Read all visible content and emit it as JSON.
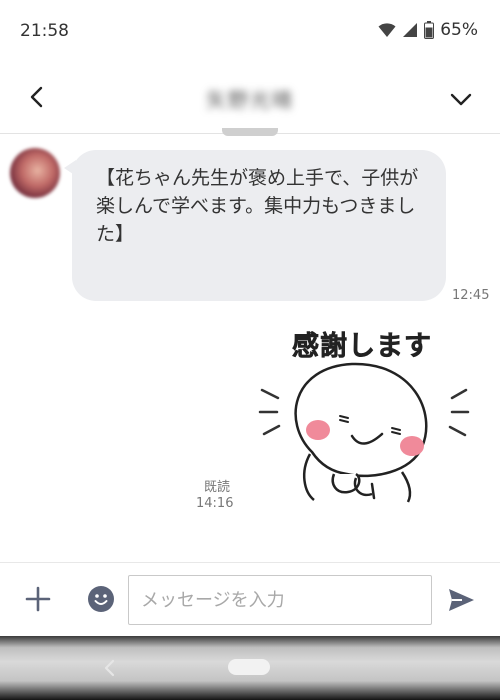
{
  "status_bar": {
    "time": "21:58",
    "battery": "65%",
    "icons": [
      "wifi-icon",
      "cell-signal-icon",
      "battery-icon"
    ]
  },
  "header": {
    "contact_name": "矢野光晴",
    "back_icon": "chevron-left-icon",
    "menu_icon": "chevron-down-icon"
  },
  "messages": [
    {
      "sender": "contact",
      "text": "【花ちゃん先生が褒め上手で、子供が楽しんで学べます。集中力もつきました】",
      "time": "12:45"
    },
    {
      "sender": "self",
      "type": "sticker",
      "sticker_text": "感謝します",
      "read_status": "既読",
      "time": "14:16"
    }
  ],
  "input_bar": {
    "placeholder": "メッセージを入力",
    "value": "",
    "icons": [
      "plus-icon",
      "emoji-icon",
      "send-icon"
    ]
  },
  "colors": {
    "bubble": "#ecedf0",
    "icon_slate": "#5b6378",
    "cheek_pink": "#f08a9a"
  }
}
